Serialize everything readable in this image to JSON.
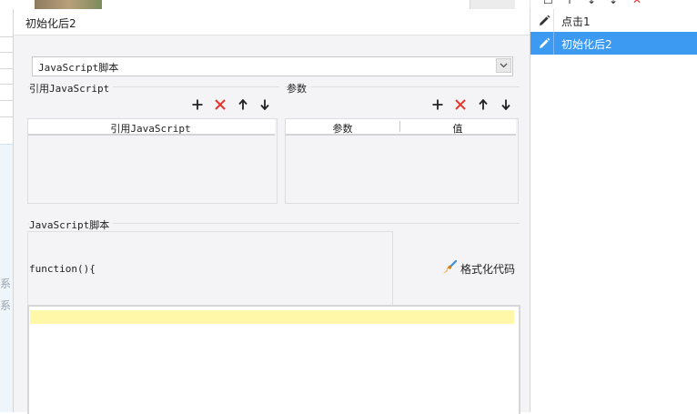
{
  "background": {
    "side_chars": [
      "系",
      "系"
    ]
  },
  "right_panel": {
    "items": [
      {
        "label": "点击1",
        "icon": "pencil-icon",
        "selected": false
      },
      {
        "label": "初始化后2",
        "icon": "pencil-icon",
        "selected": true
      }
    ],
    "toolbar_icons": [
      "add-icon",
      "up-icon",
      "down-icon",
      "delete-icon"
    ]
  },
  "dialog": {
    "title": "初始化后2",
    "script_select": {
      "value": "JavaScript脚本"
    },
    "ref_js": {
      "group_label": "引用JavaScript",
      "column_header": "引用JavaScript",
      "toolbar_icons": [
        "add-icon",
        "delete-icon",
        "arrow-up-icon",
        "arrow-down-icon"
      ]
    },
    "params": {
      "group_label": "参数",
      "columns": [
        "参数",
        "值"
      ],
      "toolbar_icons": [
        "add-icon",
        "delete-icon",
        "arrow-up-icon",
        "arrow-down-icon"
      ]
    },
    "script": {
      "group_label": "JavaScript脚本",
      "function_header": "function(){",
      "format_button": "格式化代码"
    }
  },
  "colors": {
    "selection_blue": "#3d9af3",
    "delete_red": "#e8342b",
    "editor_highlight": "#fff8a8"
  }
}
